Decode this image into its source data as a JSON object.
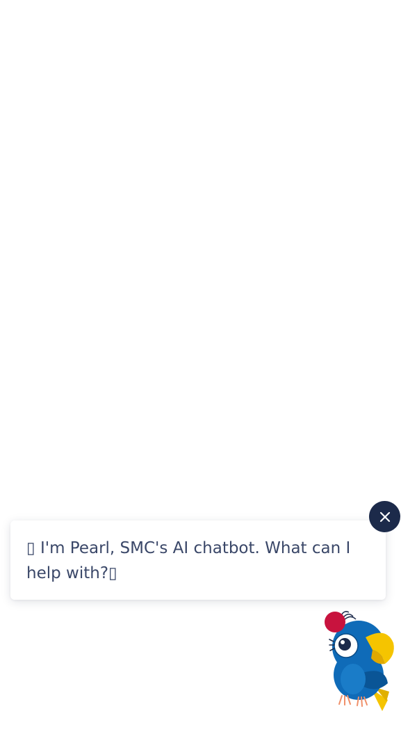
{
  "chat_teaser": {
    "message": "▯ I'm Pearl, SMC's AI chatbot. What can I help with?▯"
  },
  "close_button": {
    "icon": "close-icon",
    "color": "#1c2a4a"
  },
  "mascot": {
    "icon": "parrot-mascot-icon",
    "body_color": "#0f6bb8",
    "beak_color": "#f5c400",
    "accent_color": "#c8133e"
  }
}
